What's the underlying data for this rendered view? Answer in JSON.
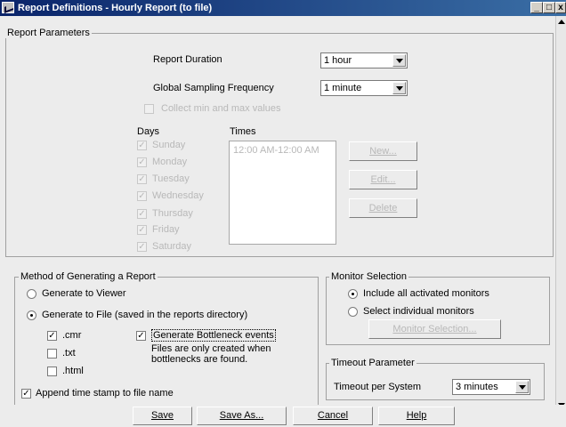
{
  "window": {
    "title": "Report Definitions - Hourly Report (to file)",
    "minimize": "_",
    "maximize": "□",
    "close": "x"
  },
  "report_parameters": {
    "legend": "Report Parameters",
    "duration_label": "Report Duration",
    "duration_value": "1 hour",
    "sampling_label": "Global Sampling Frequency",
    "sampling_value": "1 minute",
    "collect_label": "Collect min and max values",
    "days_header": "Days",
    "times_header": "Times",
    "days": [
      "Sunday",
      "Monday",
      "Tuesday",
      "Wednesday",
      "Thursday",
      "Friday",
      "Saturday"
    ],
    "times": [
      "12:00 AM-12:00 AM"
    ],
    "new_button": "New...",
    "edit_button": "Edit...",
    "delete_button": "Delete"
  },
  "method": {
    "legend": "Method of Generating a Report",
    "viewer_label": "Generate to Viewer",
    "file_label": "Generate to File (saved in the reports directory)",
    "cmr_label": ".cmr",
    "txt_label": ".txt",
    "html_label": ".html",
    "bottleneck_label": "Generate Bottleneck events",
    "bottleneck_note_1": "Files are only created when",
    "bottleneck_note_2": "bottlenecks are found.",
    "timestamp_label": "Append time stamp to file name"
  },
  "monitor_selection": {
    "legend": "Monitor Selection",
    "include_all_label": "Include all activated monitors",
    "select_individual_label": "Select individual monitors",
    "button": "Monitor Selection..."
  },
  "timeout": {
    "legend": "Timeout Parameter",
    "label": "Timeout per System",
    "value": "3 minutes"
  },
  "buttons": {
    "save": "Save",
    "save_as": "Save As...",
    "cancel": "Cancel",
    "help": "Help"
  }
}
